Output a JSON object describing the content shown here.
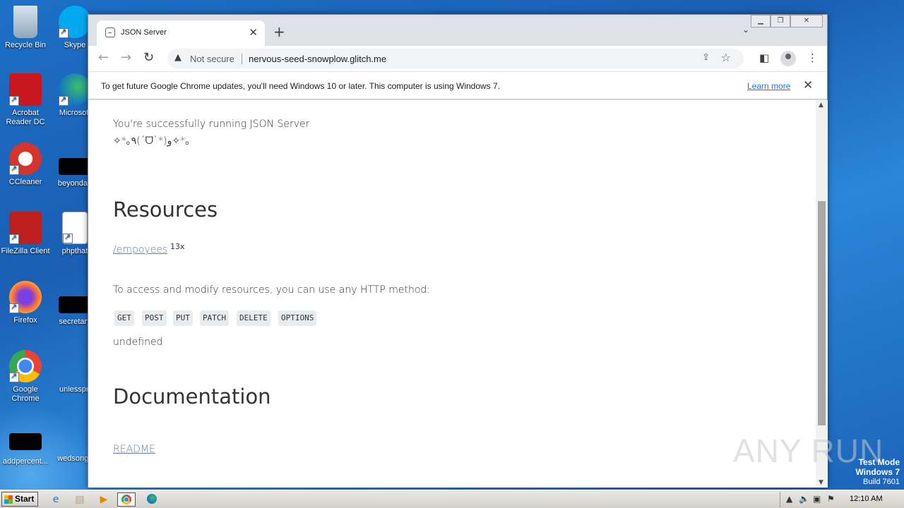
{
  "desktop": {
    "icons": [
      {
        "label": "Recycle Bin"
      },
      {
        "label": "Skype"
      },
      {
        "label": "Acrobat Reader DC"
      },
      {
        "label": "Microsoft"
      },
      {
        "label": "CCleaner"
      },
      {
        "label": "beyondag"
      },
      {
        "label": "FileZilla Client"
      },
      {
        "label": "phpthat"
      },
      {
        "label": "Firefox"
      },
      {
        "label": "secretary"
      },
      {
        "label": "Google Chrome"
      },
      {
        "label": "unlesspri"
      },
      {
        "label": "addpercent..."
      },
      {
        "label": "wedsongs"
      }
    ],
    "watermark": "ANY RUN",
    "test_mode": {
      "line1": "Test Mode",
      "line2": "Windows 7",
      "line3": "Build 7601"
    }
  },
  "browser": {
    "tab_title": "JSON Server",
    "security_label": "Not secure",
    "url": "nervous-seed-snowplow.glitch.me",
    "infobar": {
      "message": "To get future Google Chrome updates, you'll need Windows 10 or later. This computer is using Windows 7.",
      "link": "Learn more"
    }
  },
  "page": {
    "intro": "You're successfully running JSON Server",
    "kaomoji": "✧*｡٩(ˊᗜˋ*)و✧*｡",
    "resources_heading": "Resources",
    "resource_link": "/empoyees",
    "resource_count": "13x",
    "access_text": "To access and modify resources, you can use any HTTP method:",
    "methods": [
      "GET",
      "POST",
      "PUT",
      "PATCH",
      "DELETE",
      "OPTIONS"
    ],
    "undefined_text": "undefined",
    "documentation_heading": "Documentation",
    "readme_link": "README"
  },
  "taskbar": {
    "start_label": "Start",
    "clock": "12:10 AM"
  }
}
